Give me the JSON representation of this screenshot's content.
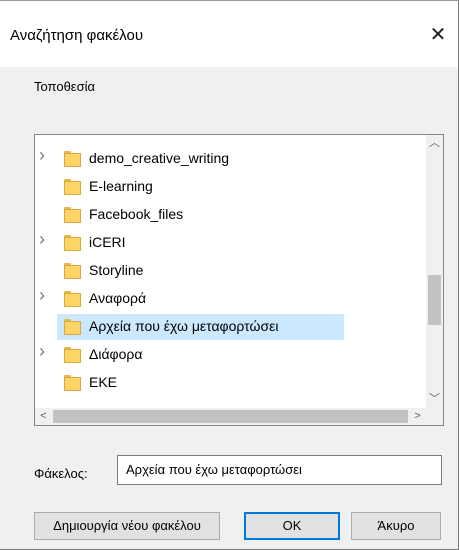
{
  "window": {
    "title": "Αναζήτηση φακέλου",
    "close_glyph": "✕"
  },
  "location_label": "Τοποθεσία",
  "tree": {
    "items": [
      {
        "label": "demo_creative_writing",
        "expandable": true,
        "selected": false
      },
      {
        "label": "E-learning",
        "expandable": false,
        "selected": false
      },
      {
        "label": "Facebook_files",
        "expandable": false,
        "selected": false
      },
      {
        "label": "iCERI",
        "expandable": true,
        "selected": false
      },
      {
        "label": "Storyline",
        "expandable": false,
        "selected": false
      },
      {
        "label": "Αναφορά",
        "expandable": true,
        "selected": false
      },
      {
        "label": "Αρχεία που έχω μεταφορτώσει",
        "expandable": false,
        "selected": true
      },
      {
        "label": "Διάφορα",
        "expandable": true,
        "selected": false
      },
      {
        "label": "ΕΚΕ",
        "expandable": false,
        "selected": false
      }
    ],
    "icons": {
      "expand": "chevron-right-icon",
      "folder": "folder-icon",
      "scroll_up": "scroll-up-arrow-icon",
      "scroll_down": "scroll-down-arrow-icon",
      "scroll_left": "scroll-left-arrow-icon",
      "scroll_right": "scroll-right-arrow-icon"
    }
  },
  "folder_field": {
    "label": "Φάκελος:",
    "value": "Αρχεία που έχω μεταφορτώσει"
  },
  "buttons": {
    "new_folder": "Δημιουργία νέου φακέλου",
    "ok": "OK",
    "cancel": "Άκυρο"
  },
  "colors": {
    "selection": "#cce8ff",
    "default_button_border": "#0078d7",
    "folder": "#ffd466"
  }
}
